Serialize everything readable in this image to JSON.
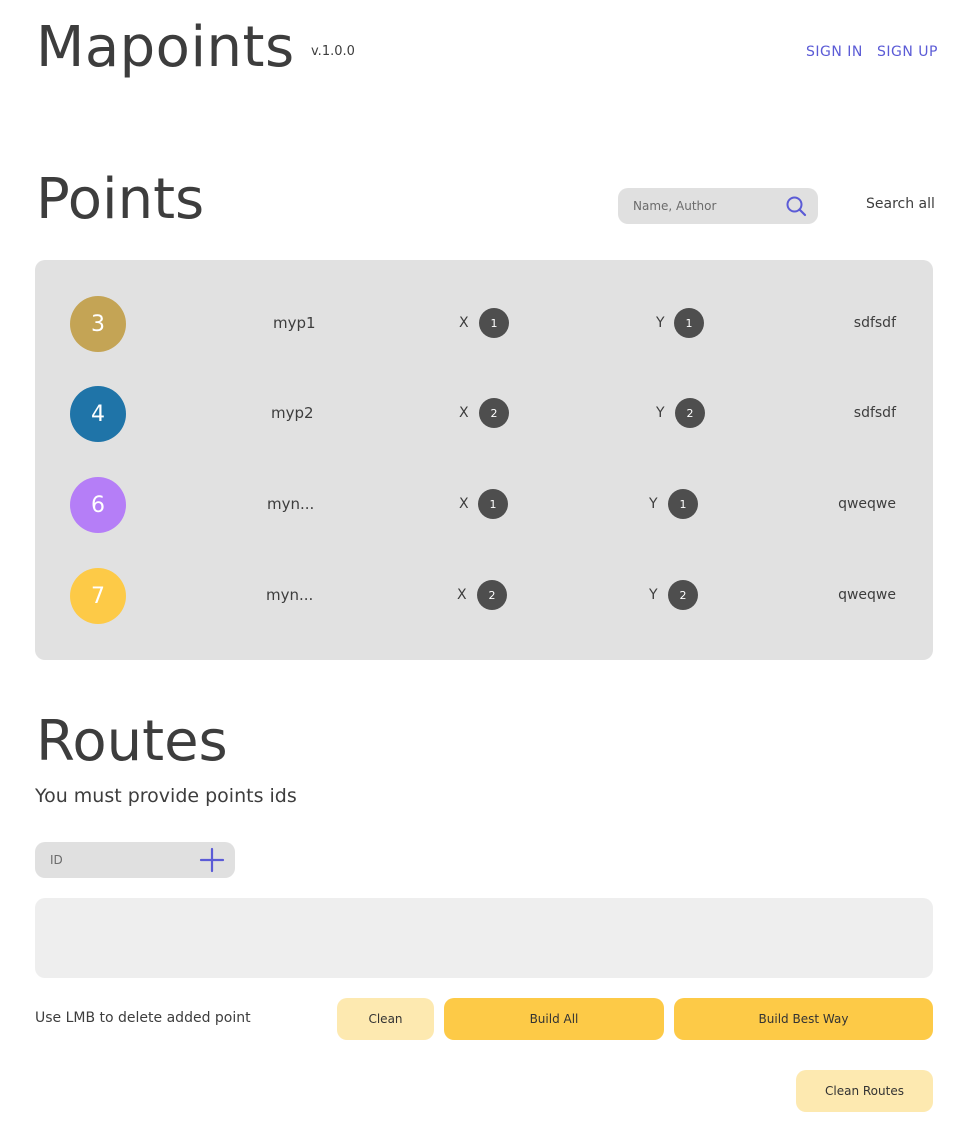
{
  "header": {
    "logo": "Mapoints",
    "version": "v.1.0.0",
    "sign_in": "SIGN IN",
    "sign_up": "SIGN UP"
  },
  "points": {
    "title": "Points",
    "search_placeholder": "Name, Author",
    "search_all": "Search all",
    "items": [
      {
        "id": "3",
        "color": "#c4a455",
        "name": "myp1",
        "x_label": "X",
        "x": "1",
        "y_label": "Y",
        "y": "1",
        "author": "sdfsdf"
      },
      {
        "id": "4",
        "color": "#1f74a8",
        "name": "myp2",
        "x_label": "X",
        "x": "2",
        "y_label": "Y",
        "y": "2",
        "author": "sdfsdf"
      },
      {
        "id": "6",
        "color": "#b57ef7",
        "name": "myn...",
        "x_label": "X",
        "x": "1",
        "y_label": "Y",
        "y": "1",
        "author": "qweqwe"
      },
      {
        "id": "7",
        "color": "#fdca47",
        "name": "myn...",
        "x_label": "X",
        "x": "2",
        "y_label": "Y",
        "y": "2",
        "author": "qweqwe"
      }
    ]
  },
  "routes": {
    "title": "Routes",
    "subtitle": "You must provide points ids",
    "id_placeholder": "ID",
    "hint": "Use LMB to delete added point",
    "clean": "Clean",
    "build_all": "Build All",
    "build_best": "Build Best Way",
    "clean_routes": "Clean Routes"
  },
  "colors": {
    "accent": "#5b5bd6",
    "button_primary": "#fdca47",
    "button_secondary": "#fde9b0",
    "panel": "#e1e1e1"
  },
  "icons": {
    "search": "search-icon",
    "add": "plus-icon"
  }
}
